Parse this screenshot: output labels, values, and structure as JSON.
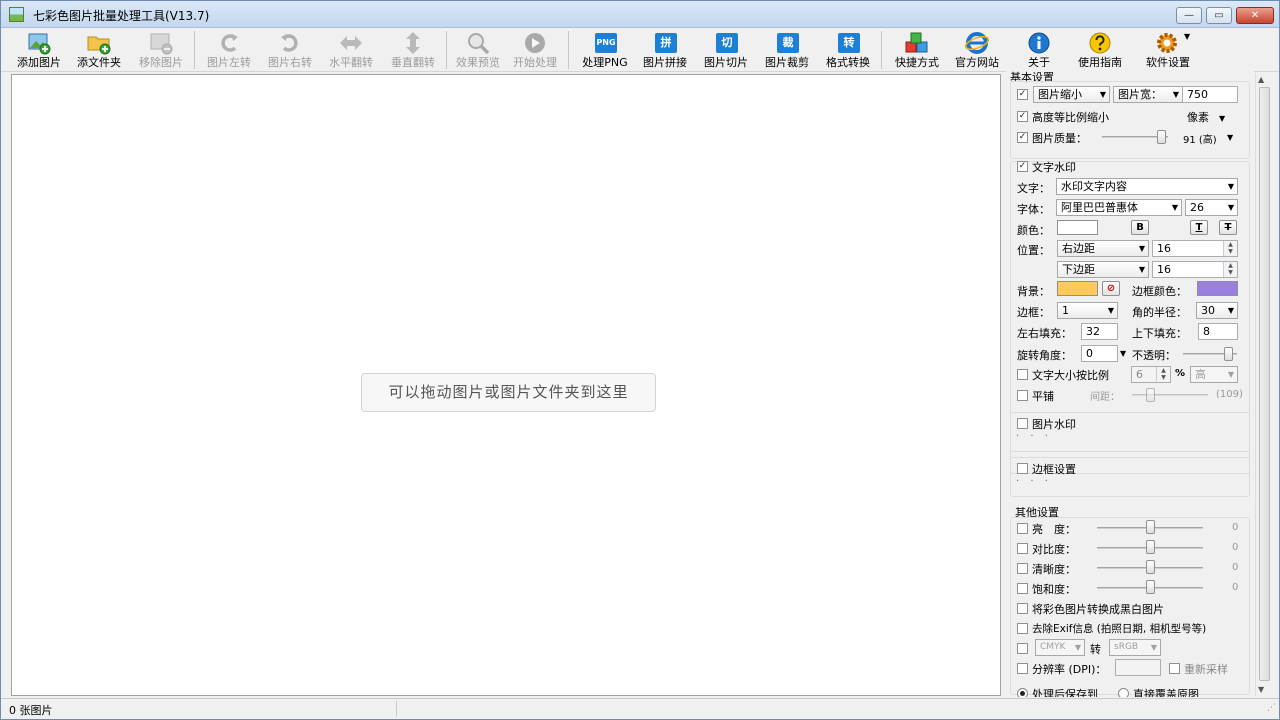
{
  "window": {
    "title": "七彩色图片批量处理工具(V13.7)",
    "min_glyph": "—",
    "max_glyph": "▭",
    "close_glyph": "✕"
  },
  "toolbar": {
    "add_images": "添加图片",
    "add_folder": "添文件夹",
    "remove_images": "移除图片",
    "rotate_left": "图片左转",
    "rotate_right": "图片右转",
    "flip_horizontal": "水平翻转",
    "flip_vertical": "垂直翻转",
    "preview": "效果预览",
    "start": "开始处理",
    "process_png": "处理PNG",
    "png_badge": "PNG",
    "stitch": "图片拼接",
    "stitch_badge": "拼",
    "slice": "图片切片",
    "slice_badge": "切",
    "crop": "图片裁剪",
    "crop_badge": "裁",
    "convert": "格式转换",
    "convert_badge": "转",
    "shortcuts": "快捷方式",
    "website": "官方网站",
    "about": "关于",
    "guide": "使用指南",
    "settings": "软件设置"
  },
  "canvas": {
    "drop_hint": "可以拖动图片或图片文件夹到这里"
  },
  "basic": {
    "title": "基本设置",
    "resize_mode": "图片缩小",
    "resize_dim": "图片宽：",
    "resize_value": "750",
    "keep_ratio": "高度等比例缩小",
    "unit": "像素",
    "quality_label": "图片质量：",
    "quality_value": 91,
    "quality_text": "91 (高)"
  },
  "text_watermark": {
    "title": "文字水印",
    "text_label": "文字：",
    "text_value": "水印文字内容",
    "font_label": "字体：",
    "font_value": "阿里巴巴普惠体",
    "font_size": "26",
    "color_label": "颜色：",
    "bold": "B",
    "underline": "T",
    "strike": "T",
    "position_label": "位置：",
    "h_anchor": "右边距",
    "h_value": "16",
    "v_anchor": "下边距",
    "v_value": "16",
    "bg_label": "背景：",
    "bg_color": "#ffc95c",
    "border_color_label": "边框颜色：",
    "border_color": "#9a7fe0",
    "border_label": "边框：",
    "border_value": "1",
    "radius_label": "角的半径：",
    "radius_value": "30",
    "pad_lr_label": "左右填充：",
    "pad_lr": "32",
    "pad_tb_label": "上下填充：",
    "pad_tb": "8",
    "rotate_label": "旋转角度：",
    "rotate_value": "0",
    "opacity_label": "不透明：",
    "opacity_value": 0.85,
    "scale_label": "文字大小按比例",
    "scale_value": "6",
    "percent": "%",
    "scale_base": "高",
    "tile_label": "平铺",
    "spacing_label": "间距：",
    "spacing_value": "(109)"
  },
  "image_watermark": {
    "title": "图片水印",
    "dots": "· · ·"
  },
  "border_settings": {
    "title": "边框设置",
    "dots": "· · ·"
  },
  "other": {
    "title": "其他设置",
    "brightness": "亮　度：",
    "brightness_value": "0",
    "contrast": "对比度：",
    "contrast_value": "0",
    "sharpness": "清晰度：",
    "sharpness_value": "0",
    "saturation": "饱和度：",
    "saturation_value": "0",
    "grayscale": "将彩色图片转换成黑白图片",
    "strip_exif": "去除Exif信息 (拍照日期, 相机型号等)",
    "color_from": "CMYK",
    "to": "转",
    "color_to": "sRGB",
    "dpi_label": "分辨率 (DPI)：",
    "resample": "重新采样"
  },
  "output": {
    "save_to": "处理后保存到",
    "overwrite": "直接覆盖原图"
  },
  "status": {
    "count": "0 张图片"
  }
}
